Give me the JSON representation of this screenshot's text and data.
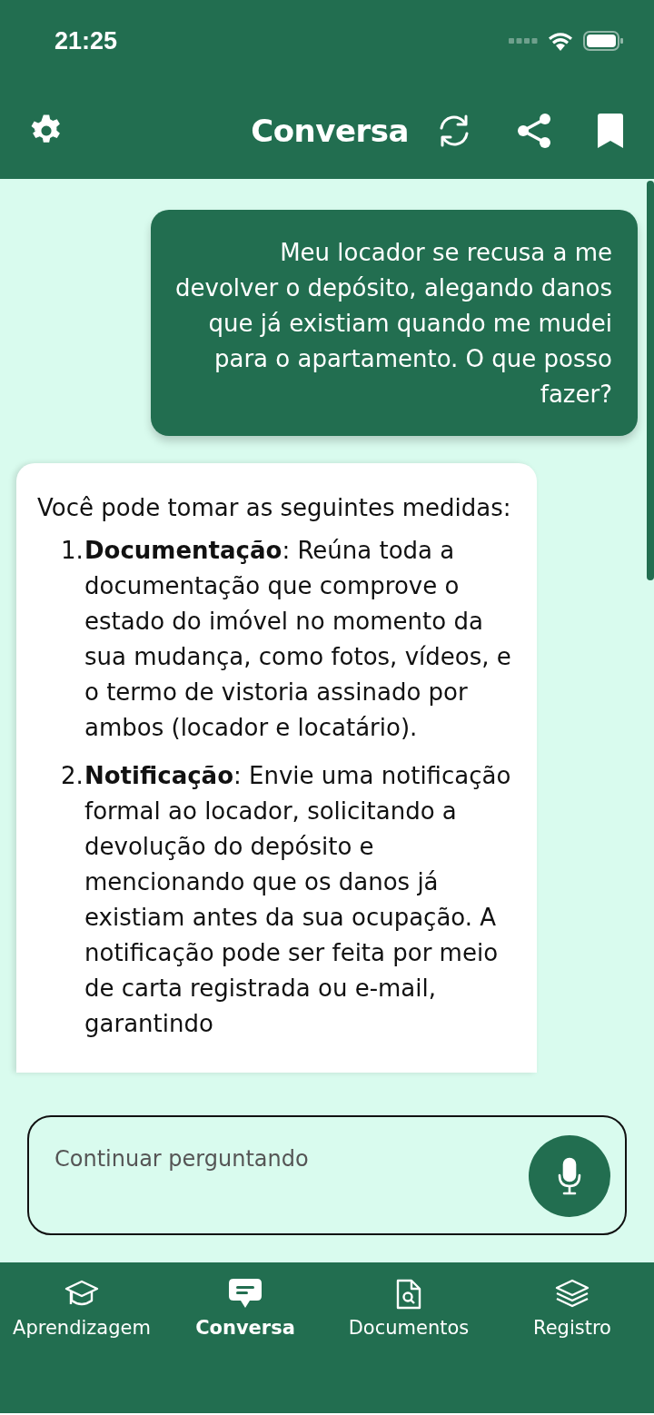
{
  "status_bar": {
    "time": "21:25"
  },
  "app_bar": {
    "title": "Conversa"
  },
  "messages": [
    {
      "kind": "user",
      "paragraphs": [
        "Meu locador se recusa a me devolver o depósito, alegando danos que já existiam quando me mudei para o apartamento. O que posso fazer?"
      ]
    },
    {
      "kind": "assistant",
      "paragraphs": [
        "Você pode tomar as seguintes medidas:"
      ],
      "list": [
        {
          "number": "1.",
          "text": "**Documentação**: Reúna toda a documentação que comprove o estado do imóvel no momento da sua mudança, como fotos, vídeos, e o termo de vistoria assinado por ambos (locador e locatário)."
        },
        {
          "number": "2.",
          "text": "**Notificação**: Envie uma notificação formal ao locador, solicitando a devolução do depósito e mencionando que os danos já existiam antes da sua ocupação. A notificação pode ser feita por meio de carta registrada ou e-mail, garantindo"
        }
      ]
    }
  ],
  "input": {
    "placeholder": "Continuar perguntando"
  },
  "tabs": [
    {
      "label": "Aprendizagem",
      "selected": false
    },
    {
      "label": "Conversa",
      "selected": true
    },
    {
      "label": "Documentos",
      "selected": false
    },
    {
      "label": "Registro",
      "selected": false
    }
  ]
}
